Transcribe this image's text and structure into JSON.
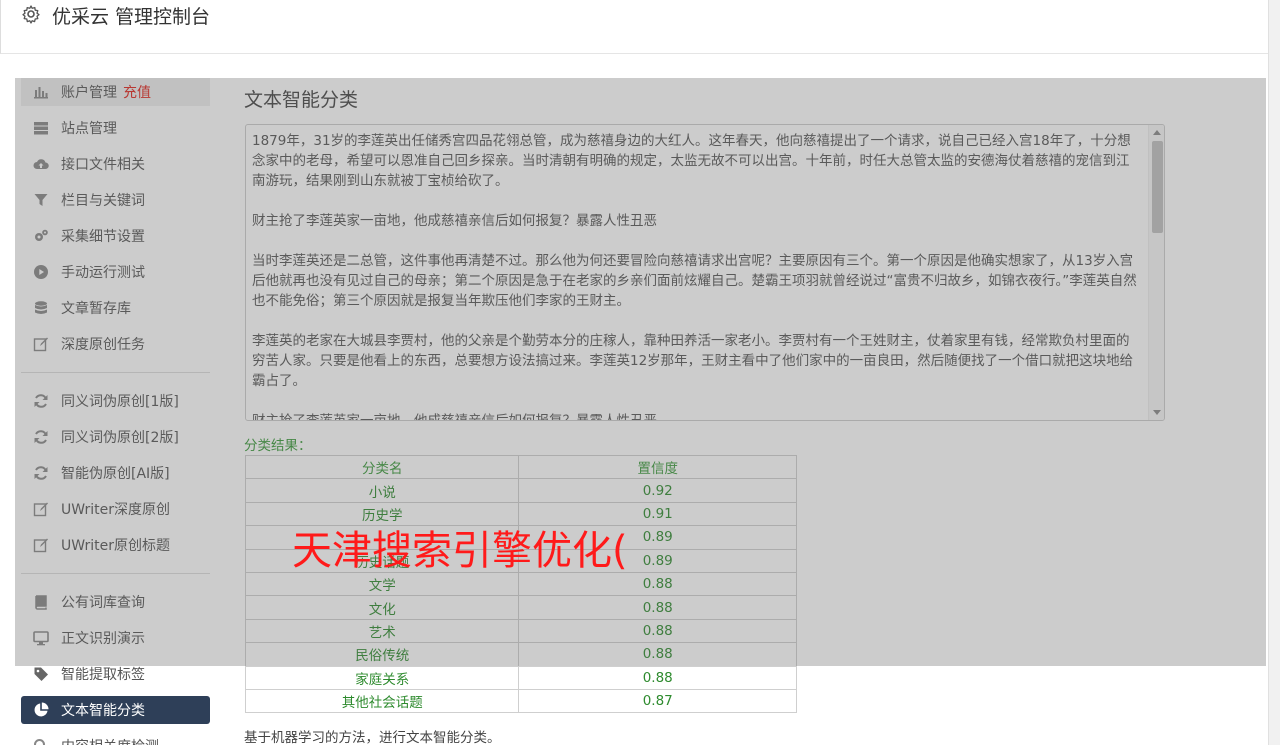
{
  "header": {
    "app_title": "优采云 管理控制台",
    "icon": "gear-icon"
  },
  "sidebar": {
    "items": [
      {
        "label": "账户管理",
        "badge": "充值",
        "icon": "bar-chart-icon"
      },
      {
        "label": "站点管理",
        "icon": "server-icon"
      },
      {
        "label": "接口文件相关",
        "icon": "cloud-upload-icon"
      },
      {
        "label": "栏目与关键词",
        "icon": "filter-icon"
      },
      {
        "label": "采集细节设置",
        "icon": "cogs-icon"
      },
      {
        "label": "手动运行测试",
        "icon": "play-circle-icon"
      },
      {
        "label": "文章暂存库",
        "icon": "database-icon"
      },
      {
        "label": "深度原创任务",
        "icon": "edit-icon"
      },
      {
        "label": "同义词伪原创[1版]",
        "icon": "refresh-icon"
      },
      {
        "label": "同义词伪原创[2版]",
        "icon": "refresh-icon"
      },
      {
        "label": "智能伪原创[AI版]",
        "icon": "refresh-icon"
      },
      {
        "label": "UWriter深度原创",
        "icon": "edit-icon"
      },
      {
        "label": "UWriter原创标题",
        "icon": "edit-icon"
      },
      {
        "label": "公有词库查询",
        "icon": "book-icon"
      },
      {
        "label": "正文识别演示",
        "icon": "desktop-icon"
      },
      {
        "label": "智能提取标签",
        "icon": "tag-icon"
      },
      {
        "label": "文本智能分类",
        "icon": "pie-chart-icon",
        "active": true
      },
      {
        "label": "内容相关度检测",
        "icon": "search-icon"
      }
    ]
  },
  "main": {
    "title": "文本智能分类",
    "text_paragraphs": [
      "1879年，31岁的李莲英出任储秀宫四品花翎总管，成为慈禧身边的大红人。这年春天，他向慈禧提出了一个请求，说自己已经入宫18年了，十分想念家中的老母，希望可以恩准自己回乡探亲。当时清朝有明确的规定，太监无故不可以出宫。十年前，时任大总管太监的安德海仗着慈禧的宠信到江南游玩，结果刚到山东就被丁宝桢给砍了。",
      "财主抢了李莲英家一亩地，他成慈禧亲信后如何报复？暴露人性丑恶",
      "当时李莲英还是二总管，这件事他再清楚不过。那么他为何还要冒险向慈禧请求出宫呢？主要原因有三个。第一个原因是他确实想家了，从13岁入宫后他就再也没有见过自己的母亲；第二个原因是急于在老家的乡亲们面前炫耀自己。楚霸王项羽就曾经说过“富贵不归故乡，如锦衣夜行。”李莲英自然也不能免俗；第三个原因就是报复当年欺压他们李家的王财主。",
      "李莲英的老家在大城县李贾村，他的父亲是个勤劳本分的庄稼人，靠种田养活一家老小。李贾村有一个王姓财主，仗着家里有钱，经常欺负村里面的穷苦人家。只要是他看上的东西，总要想方设法搞过来。李莲英12岁那年，王财主看中了他们家中的一亩良田，然后随便找了一个借口就把这块地给霸占了。",
      "财主抢了李莲英家一亩地，他成慈禧亲信后如何报复？暴露人性丑恶"
    ],
    "result_label": "分类结果：",
    "table": {
      "headers": [
        "分类名",
        "置信度"
      ],
      "rows": [
        [
          "小说",
          "0.92"
        ],
        [
          "历史学",
          "0.91"
        ],
        [
          "",
          "0.89"
        ],
        [
          "历史话题",
          "0.89"
        ],
        [
          "文学",
          "0.88"
        ],
        [
          "文化",
          "0.88"
        ],
        [
          "艺术",
          "0.88"
        ],
        [
          "民俗传统",
          "0.88"
        ],
        [
          "家庭关系",
          "0.88"
        ],
        [
          "其他社会话题",
          "0.87"
        ]
      ]
    },
    "description": "基于机器学习的方法，进行文本智能分类。"
  },
  "watermark": "天津搜索引擎优化(",
  "colors": {
    "active_bg": "#2e3f58",
    "result_green": "#2e8b2e",
    "recharge_red": "#e2231a",
    "watermark_red": "#ff1a1a"
  }
}
